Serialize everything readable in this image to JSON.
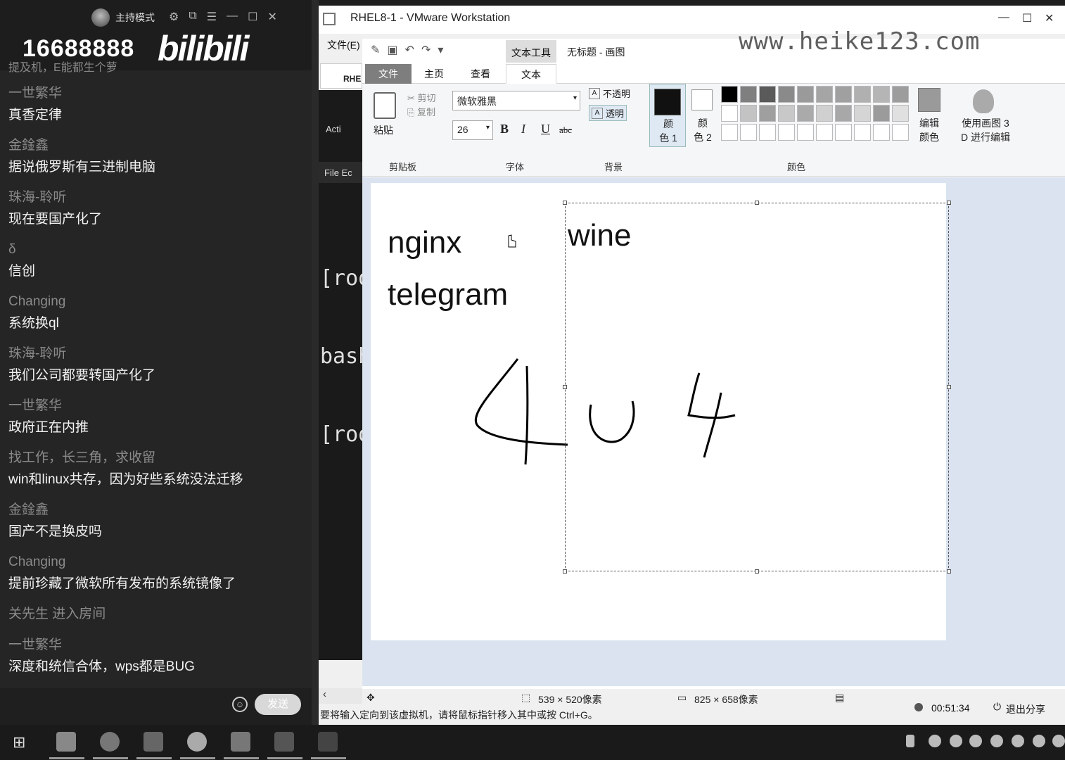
{
  "chat": {
    "mode_label": "主持模式",
    "room_number": "16688888",
    "platform_logo": "bilibili",
    "partial_message": "提及机，E能都生个萝",
    "messages": [
      {
        "user": "一世繁华",
        "text": "真香定律"
      },
      {
        "user": "金鍂鑫",
        "text": "据说俄罗斯有三进制电脑"
      },
      {
        "user": "珠海-聆听",
        "text": "现在要国产化了"
      },
      {
        "user": "δ",
        "text": "信创"
      },
      {
        "user": "Changing",
        "text": "系统换ql"
      },
      {
        "user": "珠海-聆听",
        "text": "我们公司都要转国产化了"
      },
      {
        "user": "一世繁华",
        "text": "政府正在内推"
      },
      {
        "user": "找工作，长三角，求收留",
        "text": "win和linux共存，因为好些系统没法迁移"
      },
      {
        "user": "金鍂鑫",
        "text": "国产不是换皮吗"
      },
      {
        "user": "Changing",
        "text": "提前珍藏了微软所有发布的系统镜像了"
      }
    ],
    "system_message": "关先生 进入房间",
    "last_message": {
      "user": "一世繁华",
      "text": "深度和统信合体，wps都是BUG"
    },
    "send_label": "发送"
  },
  "vmware": {
    "title": "RHEL8-1 - VMware Workstation",
    "file_menu": "文件(E)",
    "guest_tab": "RHE",
    "guest_activities": "Acti",
    "guest_menu": "File  Ec",
    "terminal_lines": [
      "[roo",
      "bash",
      "[roo"
    ],
    "hint": "要将输入定向到该虚拟机，请将鼠标指针移入其中或按 Ctrl+G。"
  },
  "paint": {
    "context_tab": "文本工具",
    "doc_title": "无标题 - 画图",
    "tabs": {
      "file": "文件",
      "home": "主页",
      "view": "查看",
      "text": "文本"
    },
    "clipboard": {
      "paste": "粘贴",
      "cut": "剪切",
      "copy": "复制",
      "label": "剪贴板"
    },
    "font": {
      "family": "微软雅黑",
      "size": "26",
      "label": "字体",
      "bold": "B",
      "italic": "I",
      "underline": "U",
      "strike": "abc"
    },
    "background": {
      "opaque": "不透明",
      "transparent": "透明",
      "label": "背景"
    },
    "colors": {
      "color1_line1": "颜",
      "color1_line2": "色 1",
      "color2_line1": "颜",
      "color2_line2": "色 2",
      "edit_line1": "编辑",
      "edit_line2": "颜色",
      "p3d_line1": "使用画图 3",
      "p3d_line2": "D 进行编辑",
      "label": "颜色"
    },
    "palette": [
      "#000000",
      "#7f7f7f",
      "#5a5a5a",
      "#8a8a8a",
      "#9a9a9a",
      "#a5a5a5",
      "#a0a0a0",
      "#b0b0b0",
      "#b5b5b5",
      "#9d9d9d",
      "#ffffff",
      "#c3c3c3",
      "#9f9f9f",
      "#c8c8c8",
      "#aaaaaa",
      "#d0d0d0",
      "#a8a8a8",
      "#d5d5d5",
      "#9b9b9b",
      "#e0e0e0",
      "#ffffff",
      "#ffffff",
      "#ffffff",
      "#ffffff",
      "#ffffff",
      "#ffffff",
      "#ffffff",
      "#ffffff",
      "#ffffff",
      "#ffffff"
    ],
    "watermark": "www.heike123.com",
    "canvas_text": {
      "nginx": "nginx",
      "telegram": "telegram",
      "wine": "wine"
    },
    "status": {
      "selection_size": "539 × 520像素",
      "image_size": "825 × 658像素"
    }
  },
  "tray": {
    "time": "00:51:34",
    "exit_share": "退出分享"
  }
}
